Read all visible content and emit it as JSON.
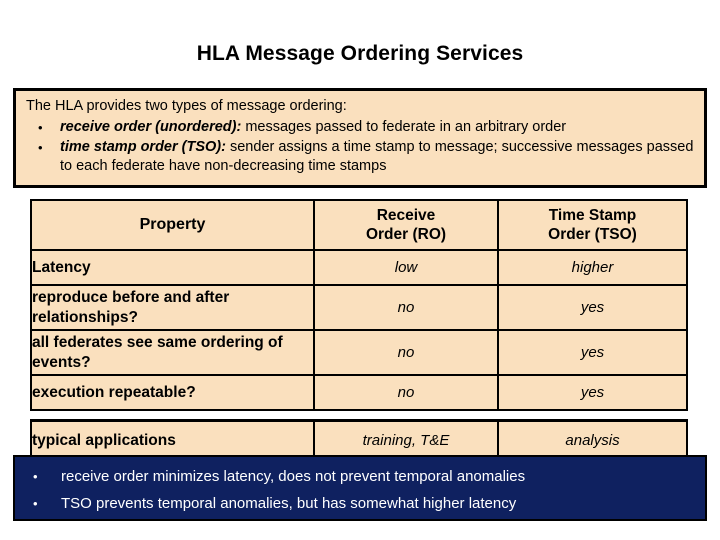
{
  "title": "HLA Message Ordering Services",
  "intro": {
    "lead": "The HLA provides two types of message ordering:",
    "bullet_glyph": "•",
    "bullets": [
      {
        "lead_in": "receive order (unordered):",
        "rest": " messages passed to federate in an arbitrary order"
      },
      {
        "lead_in": "time stamp order (TSO):",
        "rest": " sender assigns a time stamp to message; successive messages passed to each federate have non-decreasing time stamps"
      }
    ]
  },
  "table": {
    "headers": {
      "property": "Property",
      "ro_line1": "Receive",
      "ro_line2": "Order (RO)",
      "tso_line1": "Time Stamp",
      "tso_line2": "Order (TSO)"
    },
    "rows": [
      {
        "property": "Latency",
        "ro": "low",
        "tso": "higher"
      },
      {
        "property": "reproduce before and after relationships?",
        "ro": "no",
        "tso": "yes"
      },
      {
        "property": "all federates see same ordering of events?",
        "ro": "no",
        "tso": "yes"
      },
      {
        "property": "execution repeatable?",
        "ro": "no",
        "tso": "yes"
      }
    ],
    "last_row": {
      "property": "typical applications",
      "ro": "training, T&E",
      "tso": "analysis"
    }
  },
  "summary": {
    "bullet_glyph": "•",
    "bullets": [
      "receive order minimizes latency, does not prevent temporal anomalies",
      "TSO prevents temporal anomalies, but has somewhat higher latency"
    ]
  },
  "colors": {
    "panel_beige": "#fae0be",
    "summary_navy": "#0f2160",
    "border_black": "#000000",
    "summary_text": "#ffffff"
  }
}
